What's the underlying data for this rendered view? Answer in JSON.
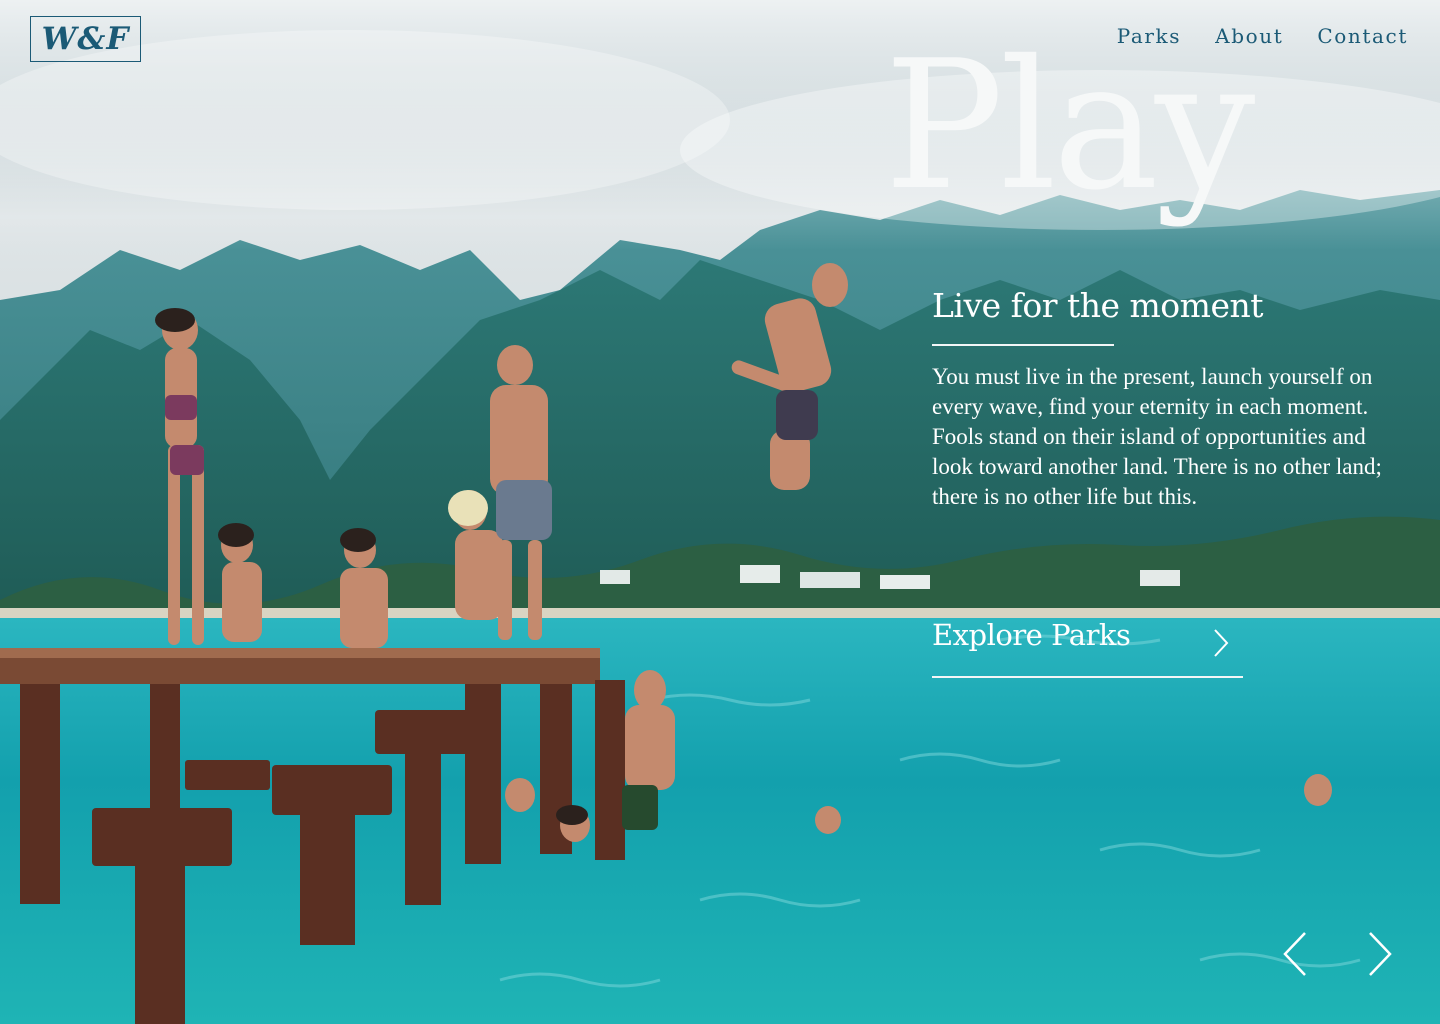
{
  "brand": {
    "logo": "W&F"
  },
  "nav": {
    "links": [
      "Parks",
      "About",
      "Contact"
    ]
  },
  "hero": {
    "headline": "Play",
    "tagline": "Live for the moment",
    "body": "You must live in the present, launch yourself on every wave, find your eternity in each moment. Fools stand on their island of opportunities and look toward another land. There is no other land; there is no other life but this.",
    "cta_label": "Explore Parks",
    "background_description_icon": "photo-background",
    "cta_icon": "chevron-right-icon",
    "prev_icon": "chevron-left-icon",
    "next_icon": "chevron-right-icon"
  },
  "colors": {
    "brand": "#1b5a76",
    "hero_text": "#ffffff",
    "water": "#1aa6b4",
    "sky": "#d7dfe1",
    "mountains": "#2f7e86"
  }
}
